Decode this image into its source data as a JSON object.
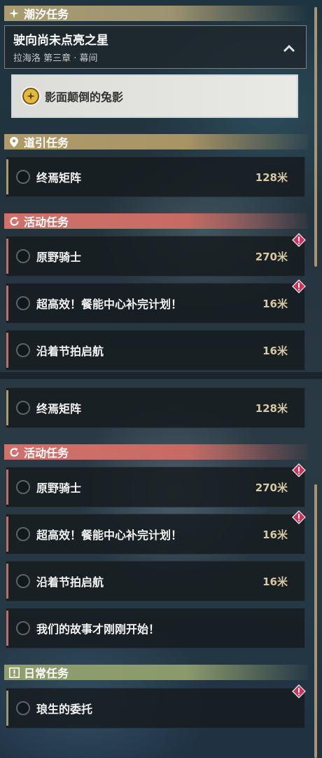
{
  "panel_a": {
    "tide_header": {
      "label": "潮汐任务",
      "icon": "star-sparkle-icon"
    },
    "main_quest": {
      "title": "驶向尚未点亮之星",
      "subtitle": "拉海洛 第三章 · 幕间",
      "collapse_icon": "chevron-up-icon"
    },
    "current_step": {
      "label": "影面颠倒的兔影",
      "icon": "compass-icon"
    },
    "guide_header": {
      "label": "道引任务",
      "icon": "location-pin-icon"
    },
    "guide_quests": [
      {
        "title": "终焉矩阵",
        "distance": "128米"
      }
    ],
    "event_header": {
      "label": "活动任务",
      "icon": "refresh-icon"
    },
    "event_quests": [
      {
        "title": "原野骑士",
        "distance": "270米",
        "alert": true
      },
      {
        "title": "超高效！餐能中心补完计划！",
        "distance": "16米",
        "alert": true
      },
      {
        "title": "沿着节拍启航",
        "distance": "16米",
        "alert": false
      }
    ]
  },
  "panel_b": {
    "guide_quests": [
      {
        "title": "终焉矩阵",
        "distance": "128米"
      }
    ],
    "event_header": {
      "label": "活动任务",
      "icon": "refresh-icon"
    },
    "event_quests": [
      {
        "title": "原野骑士",
        "distance": "270米",
        "alert": true
      },
      {
        "title": "超高效！餐能中心补完计划！",
        "distance": "16米",
        "alert": true
      },
      {
        "title": "沿着节拍启航",
        "distance": "16米",
        "alert": false
      },
      {
        "title": "我们的故事才刚刚开始！",
        "distance": "",
        "alert": false
      }
    ],
    "daily_header": {
      "label": "日常任务",
      "icon": "exclamation-box-icon"
    },
    "daily_quests": [
      {
        "title": "琅生的委托",
        "distance": "",
        "alert": true
      }
    ]
  },
  "colors": {
    "tide": "#a89c70",
    "guide": "#b09a6a",
    "event": "#d2716a",
    "daily": "#8f9e6e",
    "alert": "#d0305a",
    "distance": "#d7c8a2"
  }
}
